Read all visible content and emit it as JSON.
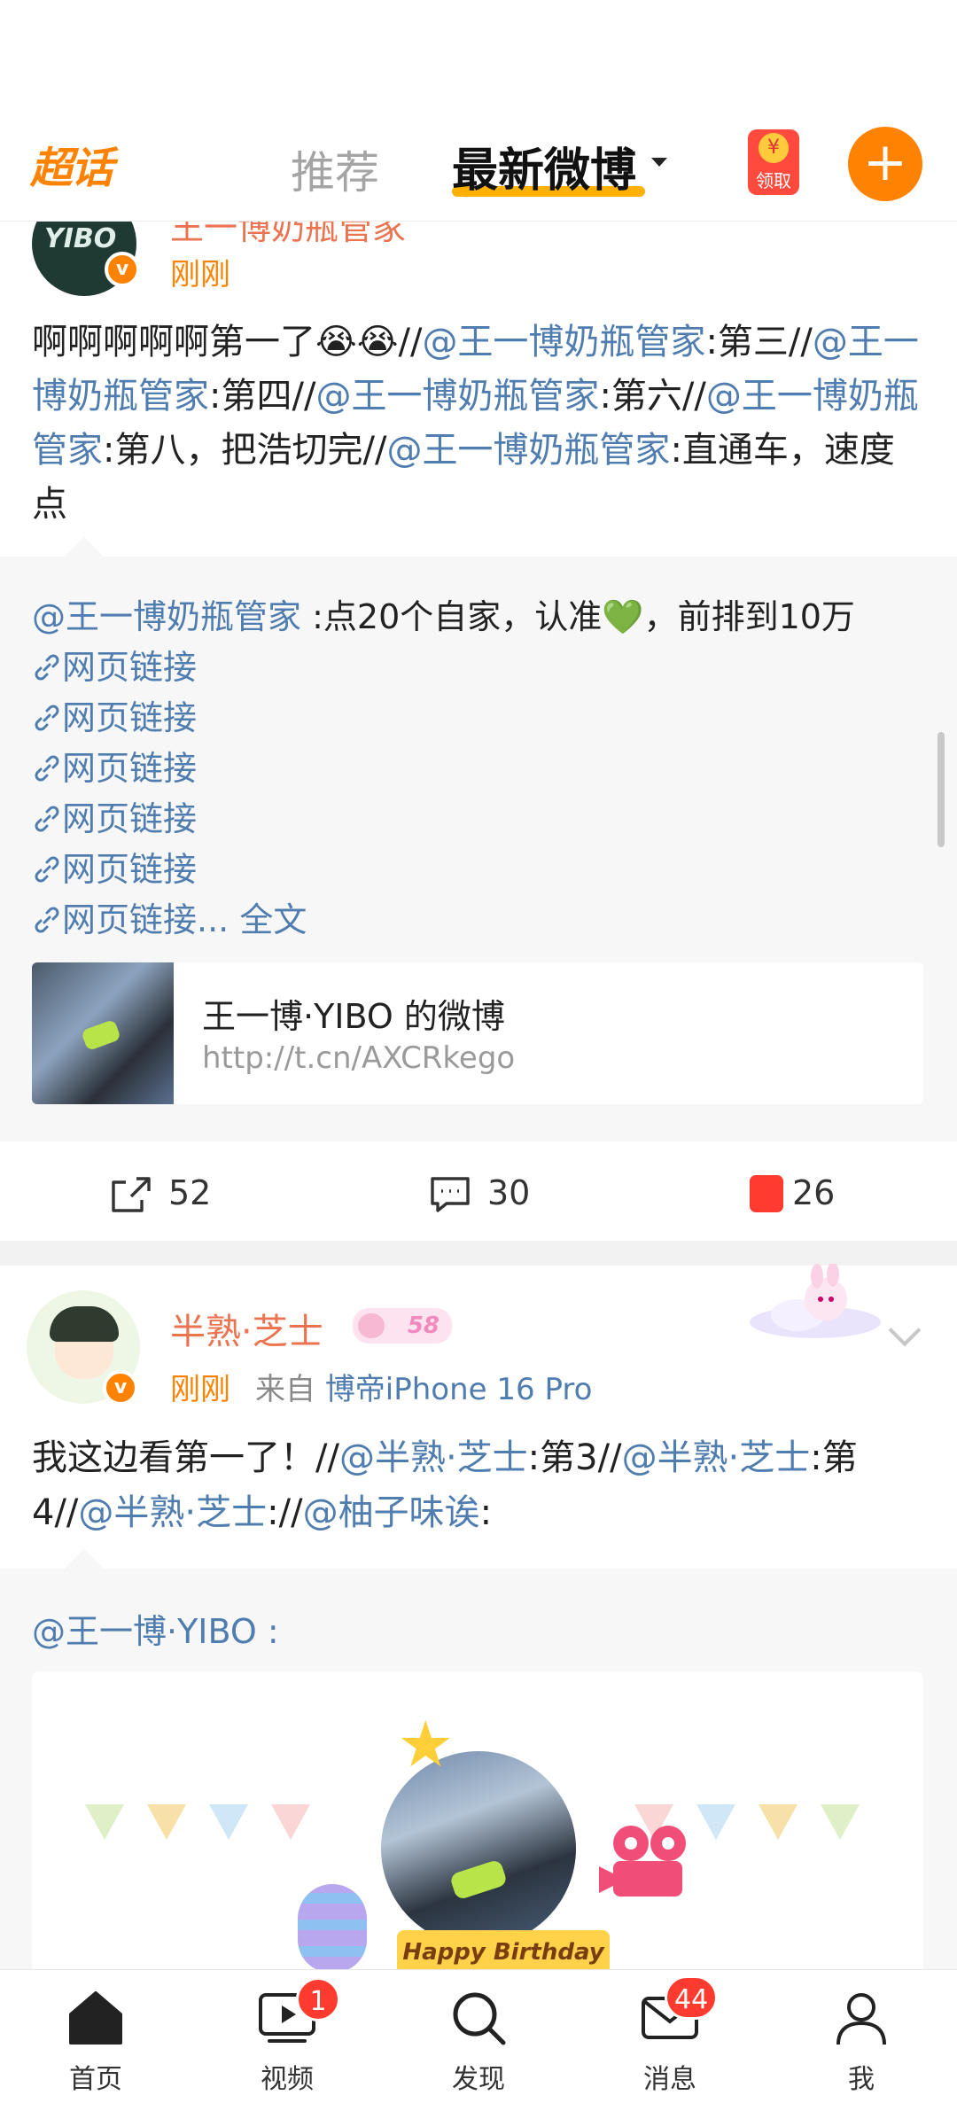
{
  "topbar": {
    "logo": "超话",
    "tab_recommend": "推荐",
    "tab_latest": "最新微博",
    "hongbao_label": "领取",
    "plus_label": "+"
  },
  "post1": {
    "name": "王一博奶瓶管家",
    "time": "刚刚",
    "segments": [
      {
        "t": "啊啊啊啊啊第一了😭😭//",
        "m": false
      },
      {
        "t": "@王一博奶瓶管家",
        "m": true
      },
      {
        "t": ":第三//",
        "m": false
      },
      {
        "t": "@王一博奶瓶管家",
        "m": true
      },
      {
        "t": ":第四//",
        "m": false
      },
      {
        "t": "@王一博奶瓶管家",
        "m": true
      },
      {
        "t": ":第六//",
        "m": false
      },
      {
        "t": "@王一博奶瓶管家",
        "m": true
      },
      {
        "t": ":第八，把浩切完//",
        "m": false
      },
      {
        "t": "@王一博奶瓶管家",
        "m": true
      },
      {
        "t": ":直通车，速度点",
        "m": false
      }
    ],
    "quote": {
      "mention": "@王一博奶瓶管家",
      "text": " :点20个自家，认准💚，前排到10万",
      "links": [
        "网页链接",
        "网页链接",
        "网页链接",
        "网页链接",
        "网页链接"
      ],
      "last_link": "网页链接...",
      "full_text": "全文",
      "card_title": "王一博·YIBO 的微博",
      "card_url": "http://t.cn/AXCRkego"
    },
    "actions": {
      "repost": "52",
      "comment": "30",
      "like": "26"
    }
  },
  "post2": {
    "name": "半熟·芝士",
    "level": "58",
    "time": "刚刚",
    "source_prefix": "来自",
    "source": "博帝iPhone 16 Pro",
    "segments": [
      {
        "t": "我这边看第一了！//",
        "m": false
      },
      {
        "t": "@半熟·芝士",
        "m": true
      },
      {
        "t": ":第3//",
        "m": false
      },
      {
        "t": "@半熟·芝士",
        "m": true
      },
      {
        "t": ":第4//",
        "m": false
      },
      {
        "t": "@半熟·芝士",
        "m": true
      },
      {
        "t": "://",
        "m": false
      },
      {
        "t": "@柚子味诶",
        "m": true
      },
      {
        "t": ":",
        "m": false
      }
    ],
    "quote_mention": "@王一博·YIBO :",
    "banner": "Happy Birthday"
  },
  "bottomnav": {
    "items": [
      {
        "label": "首页",
        "icon": "home-icon"
      },
      {
        "label": "视频",
        "icon": "video-icon",
        "badge": "1"
      },
      {
        "label": "发现",
        "icon": "search-icon"
      },
      {
        "label": "消息",
        "icon": "message-icon",
        "badge": "44"
      },
      {
        "label": "我",
        "icon": "profile-icon"
      }
    ]
  },
  "colors": {
    "brand": "#ff8200",
    "link": "#507daf",
    "name": "#eb7350",
    "badge": "#ff3b2f"
  }
}
